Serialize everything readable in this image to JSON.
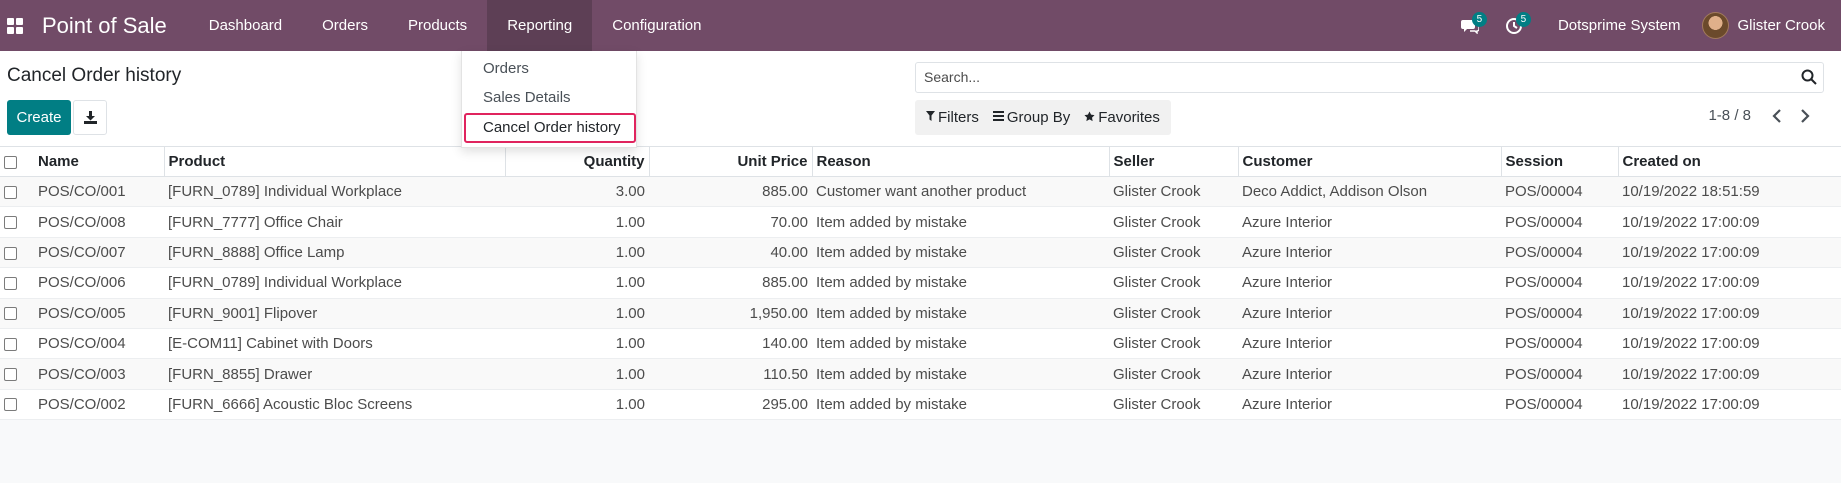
{
  "navbar": {
    "brand": "Point of Sale",
    "menu": [
      "Dashboard",
      "Orders",
      "Products",
      "Reporting",
      "Configuration"
    ],
    "messages_count": "5",
    "activities_count": "5",
    "company": "Dotsprime System",
    "user": "Glister Crook",
    "bg_color": "#714b67"
  },
  "reporting_menu": {
    "items": [
      "Orders",
      "Sales Details",
      "Cancel Order history"
    ]
  },
  "control_panel": {
    "title": "Cancel Order history",
    "create_label": "Create",
    "search_placeholder": "Search...",
    "filters_label": "Filters",
    "group_by_label": "Group By",
    "favorites_label": "Favorites",
    "pager": "1-8 / 8"
  },
  "table": {
    "columns": [
      "Name",
      "Product",
      "Quantity",
      "Unit Price",
      "Reason",
      "Seller",
      "Customer",
      "Session",
      "Created on"
    ],
    "rows": [
      [
        "POS/CO/001",
        "[FURN_0789] Individual Workplace",
        "3.00",
        "885.00",
        "Customer want another product",
        "Glister Crook",
        "Deco Addict, Addison Olson",
        "POS/00004",
        "10/19/2022 18:51:59"
      ],
      [
        "POS/CO/008",
        "[FURN_7777] Office Chair",
        "1.00",
        "70.00",
        "Item added by mistake",
        "Glister Crook",
        "Azure Interior",
        "POS/00004",
        "10/19/2022 17:00:09"
      ],
      [
        "POS/CO/007",
        "[FURN_8888] Office Lamp",
        "1.00",
        "40.00",
        "Item added by mistake",
        "Glister Crook",
        "Azure Interior",
        "POS/00004",
        "10/19/2022 17:00:09"
      ],
      [
        "POS/CO/006",
        "[FURN_0789] Individual Workplace",
        "1.00",
        "885.00",
        "Item added by mistake",
        "Glister Crook",
        "Azure Interior",
        "POS/00004",
        "10/19/2022 17:00:09"
      ],
      [
        "POS/CO/005",
        "[FURN_9001] Flipover",
        "1.00",
        "1,950.00",
        "Item added by mistake",
        "Glister Crook",
        "Azure Interior",
        "POS/00004",
        "10/19/2022 17:00:09"
      ],
      [
        "POS/CO/004",
        "[E-COM11] Cabinet with Doors",
        "1.00",
        "140.00",
        "Item added by mistake",
        "Glister Crook",
        "Azure Interior",
        "POS/00004",
        "10/19/2022 17:00:09"
      ],
      [
        "POS/CO/003",
        "[FURN_8855] Drawer",
        "1.00",
        "110.50",
        "Item added by mistake",
        "Glister Crook",
        "Azure Interior",
        "POS/00004",
        "10/19/2022 17:00:09"
      ],
      [
        "POS/CO/002",
        "[FURN_6666] Acoustic Bloc Screens",
        "1.00",
        "295.00",
        "Item added by mistake",
        "Glister Crook",
        "Azure Interior",
        "POS/00004",
        "10/19/2022 17:00:09"
      ]
    ]
  }
}
